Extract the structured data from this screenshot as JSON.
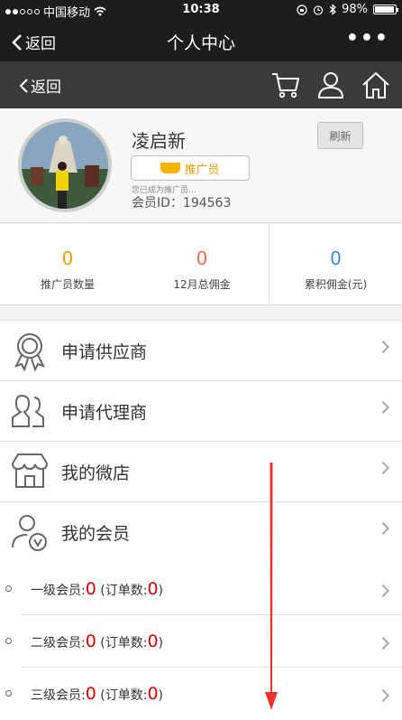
{
  "status_bar": {
    "carrier": "中国移动",
    "time": "10:38",
    "battery": "98%"
  },
  "nav_bar": {
    "back_label": "返回",
    "title": "个人中心",
    "more_label": "•••"
  },
  "sub_nav": {
    "back_label": "返回"
  },
  "profile": {
    "name": "凌启新",
    "badge_label": "推广员",
    "note": "您已成为推广员...",
    "member_id": "会员ID：194563",
    "refresh_label": "刷新"
  },
  "stats": [
    {
      "value": "0",
      "label": "推广员数量",
      "color": "#f0a000"
    },
    {
      "value": "0",
      "label": "12月总佣金",
      "color": "#f07050"
    },
    {
      "value": "0",
      "label": "累积佣金(元)",
      "color": "#2f8ef0"
    }
  ],
  "menu": [
    {
      "label": "申请供应商",
      "icon": "award-icon"
    },
    {
      "label": "申请代理商",
      "icon": "users-icon"
    },
    {
      "label": "我的微店",
      "icon": "shop-icon"
    },
    {
      "label": "我的会员",
      "icon": "member-icon"
    }
  ],
  "member_levels": [
    {
      "level": "一级会员:",
      "count": "0",
      "orders_label": " (订单数:",
      "orders": "0",
      "close": ")"
    },
    {
      "level": "二级会员:",
      "count": "0",
      "orders_label": " (订单数:",
      "orders": "0",
      "close": ")"
    },
    {
      "level": "三级会员:",
      "count": "0",
      "orders_label": " (订单数:",
      "orders": "0",
      "close": ")"
    }
  ],
  "colors": {
    "bar_dark": "#1d1d1d",
    "sub_bar": "#3a3a3a",
    "accent_red": "#e00000",
    "annotation_arrow": "#f03030"
  }
}
